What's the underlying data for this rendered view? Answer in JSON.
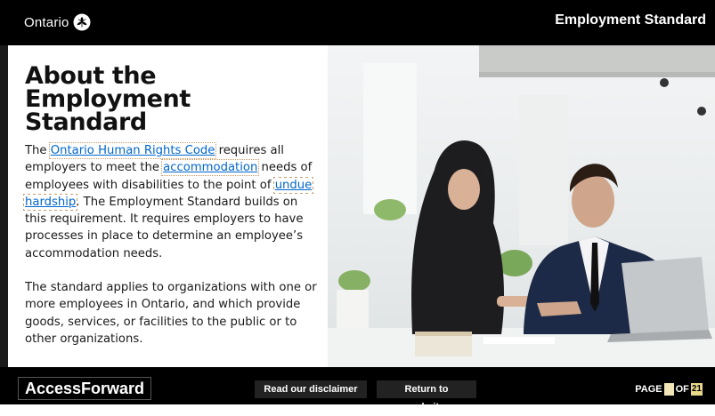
{
  "header": {
    "logo_text": "Ontario",
    "logo_icon": "trillium-icon",
    "title": "Employment Standard"
  },
  "main": {
    "title": "About the Employment Standard",
    "para1": {
      "t1": "The ",
      "link1": "Ontario Human Rights Code",
      "t2": " requires all employers to meet the ",
      "link2": "accommodation",
      "t3": " needs of employees with disabilities to the point of ",
      "link3": "undue hardship",
      "t4": ". The Employment Standard builds on this requirement. It requires employers to have processes in place to determine an employee’s accommodation needs."
    },
    "para2": "The standard applies to organizations with one or more employees in Ontario, and which provide goods, services, or facilities to the public or to other organizations."
  },
  "footer": {
    "brand": "AccessForward",
    "disclaimer_label": "Read our disclaimer",
    "return_label": "Return to website",
    "page_label": "PAGE",
    "page_current": "",
    "of_label": "OF",
    "page_total": "21"
  }
}
